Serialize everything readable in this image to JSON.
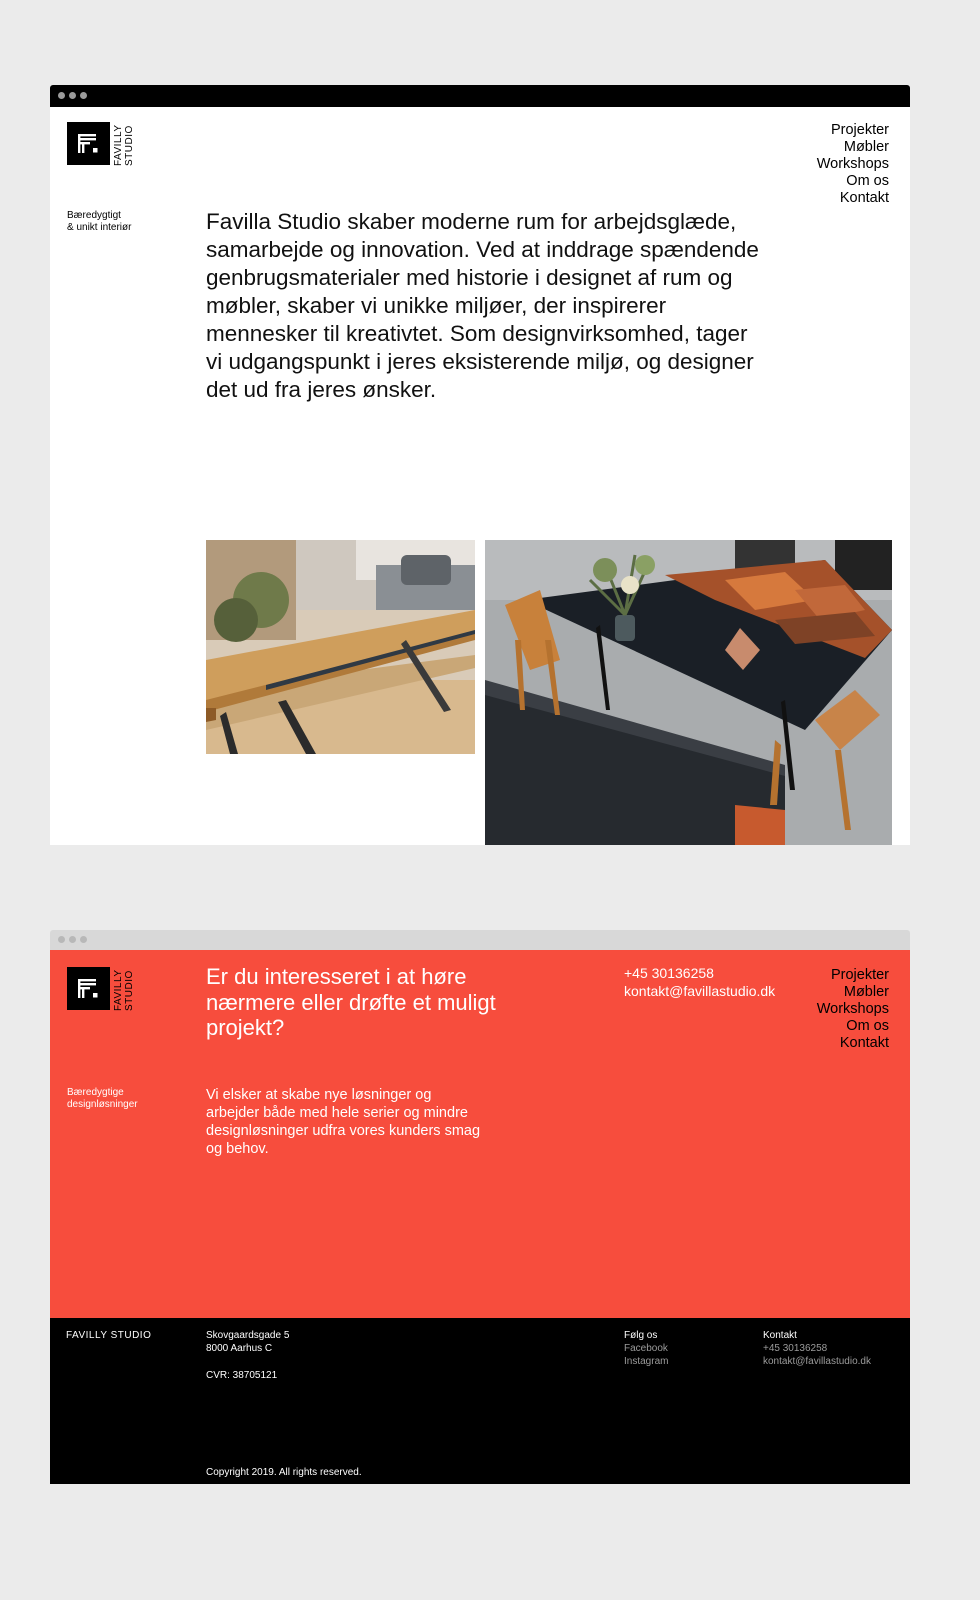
{
  "brand": {
    "name_line1": "FAVILLY",
    "name_line2": "STUDIO",
    "footer_name": "FAVILLY STUDIO"
  },
  "nav": [
    "Projekter",
    "Møbler",
    "Workshops",
    "Om os",
    "Kontakt"
  ],
  "home": {
    "tagline_1": "Bæredygtigt",
    "tagline_2": "& unikt interiør",
    "intro": "Favilla Studio skaber moderne rum for arbejdsglæde, samarbejde og innovation. Ved at inddrage spændende genbrugsmaterialer med historie i designet af rum og møbler, skaber vi unikke miljøer, der inspirerer mennesker til kreativtet. Som designvirksomhed, tager vi udgangspunkt i jeres eksisterende miljø, og designer det ud fra jeres ønsker."
  },
  "contact_page": {
    "tagline_1": "Bæredygtige",
    "tagline_2": "designløsninger",
    "headline": "Er du interesseret i at høre nærmere eller drøfte et muligt projekt?",
    "body": "Vi elsker at skabe nye løsninger og arbejder både med hele serier og mindre designløsninger udfra vores kunders smag og behov.",
    "phone": "+45 30136258",
    "email": "kontakt@favillastudio.dk"
  },
  "footer": {
    "address_1": "Skovgaardsgade 5",
    "address_2": "8000 Aarhus C",
    "cvr": "CVR: 38705121",
    "follow_title": "Følg os",
    "facebook": "Facebook",
    "instagram": "Instagram",
    "contact_title": "Kontakt",
    "phone": "+45 30136258",
    "email": "kontakt@favillastudio.dk",
    "copyright": "Copyright 2019. All rights reserved."
  },
  "colors": {
    "accent": "#f74d3d",
    "dark": "#000000",
    "background": "#ebebeb"
  },
  "icons": [
    "window-dot-icon",
    "logo-mark-icon"
  ]
}
